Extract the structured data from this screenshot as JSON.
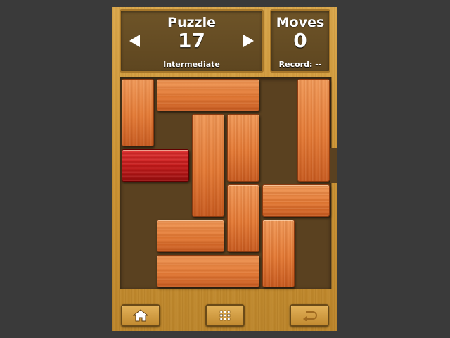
{
  "header": {
    "puzzle_title": "Puzzle",
    "puzzle_number": "17",
    "difficulty": "Intermediate",
    "moves_title": "Moves",
    "moves_count": "0",
    "record_label": "Record: --"
  },
  "board": {
    "grid_size": 6,
    "exit_row": 2,
    "blocks": [
      {
        "id": "b1",
        "col": 0,
        "row": 0,
        "len": 2,
        "orient": "v",
        "color": "orange"
      },
      {
        "id": "b2",
        "col": 1,
        "row": 0,
        "len": 3,
        "orient": "h",
        "color": "orange"
      },
      {
        "id": "b3",
        "col": 5,
        "row": 0,
        "len": 3,
        "orient": "v",
        "color": "orange"
      },
      {
        "id": "b4",
        "col": 2,
        "row": 1,
        "len": 3,
        "orient": "v",
        "color": "orange"
      },
      {
        "id": "b5",
        "col": 3,
        "row": 1,
        "len": 2,
        "orient": "v",
        "color": "orange"
      },
      {
        "id": "target",
        "col": 0,
        "row": 2,
        "len": 2,
        "orient": "h",
        "color": "red"
      },
      {
        "id": "b6",
        "col": 3,
        "row": 3,
        "len": 2,
        "orient": "v",
        "color": "orange"
      },
      {
        "id": "b7",
        "col": 4,
        "row": 3,
        "len": 2,
        "orient": "h",
        "color": "orange"
      },
      {
        "id": "b8",
        "col": 1,
        "row": 4,
        "len": 2,
        "orient": "h",
        "color": "orange"
      },
      {
        "id": "b9",
        "col": 4,
        "row": 4,
        "len": 2,
        "orient": "v",
        "color": "orange"
      },
      {
        "id": "b10",
        "col": 1,
        "row": 5,
        "len": 3,
        "orient": "h",
        "color": "orange"
      }
    ]
  },
  "toolbar": {
    "home_icon": "home-icon",
    "grid_icon": "grid-icon",
    "undo_icon": "undo-icon"
  },
  "colors": {
    "background": "#3a3a3a",
    "frame_wood": "#c99030",
    "board_bg": "#5a4120",
    "block_orange": "#e57a34",
    "block_red": "#c81818"
  }
}
